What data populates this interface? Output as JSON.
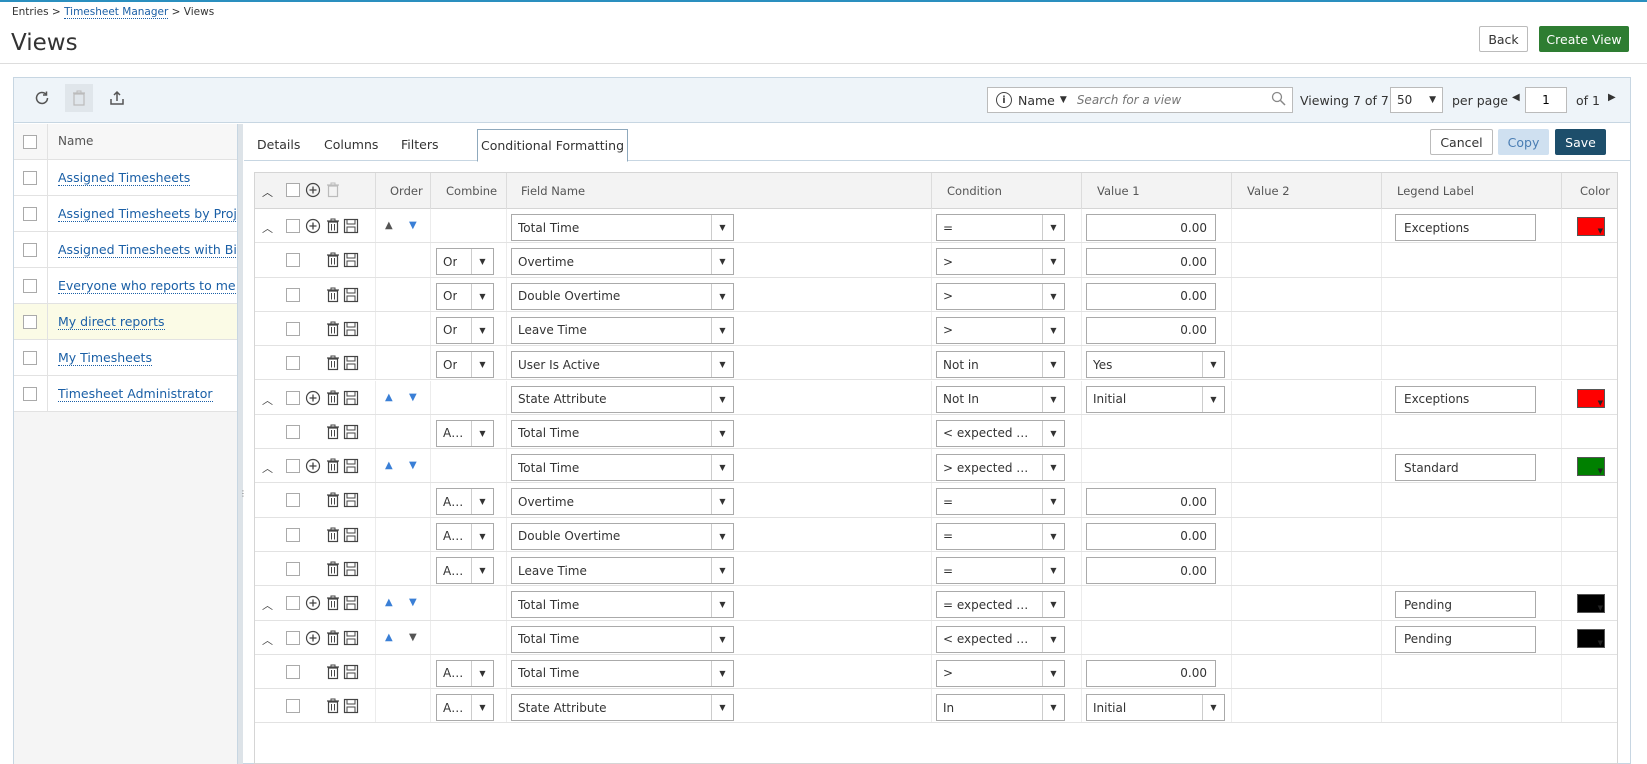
{
  "breadcrumb": {
    "entries": "Entries",
    "sep1": " > ",
    "manager": "Timesheet Manager",
    "sep2": " > ",
    "views": "Views"
  },
  "page_title": "Views",
  "header_buttons": {
    "back": "Back",
    "create": "Create View"
  },
  "toolbar": {
    "search_field": "Name",
    "search_placeholder": "Search for a view",
    "viewing_label": "Viewing",
    "viewing_count": "7 of 7",
    "per_page_value": "50",
    "per_page_label": "per page",
    "page_value": "1",
    "page_of": "of 1"
  },
  "left_list": {
    "header": "Name",
    "items": [
      "Assigned Timesheets",
      "Assigned Timesheets by Project",
      "Assigned Timesheets with Billab",
      "Everyone who reports to me",
      "My direct reports",
      "My Timesheets",
      "Timesheet Administrator"
    ],
    "selected_index": 4
  },
  "tabs": [
    "Details",
    "Columns",
    "Filters",
    "Conditional Formatting"
  ],
  "active_tab": "Conditional Formatting",
  "action_buttons": {
    "cancel": "Cancel",
    "copy": "Copy",
    "save": "Save"
  },
  "grid": {
    "headers": {
      "order": "Order",
      "combine": "Combine",
      "field": "Field Name",
      "condition": "Condition",
      "value1": "Value 1",
      "value2": "Value 2",
      "legend": "Legend Label",
      "color": "Color"
    },
    "rows": [
      {
        "group": true,
        "combine": "",
        "field": "Total Time",
        "condition": "=",
        "value1": "0.00",
        "value1_type": "number",
        "legend": "Exceptions",
        "color": "#ff0000"
      },
      {
        "group": false,
        "combine": "Or",
        "field": "Overtime",
        "condition": ">",
        "value1": "0.00",
        "value1_type": "number"
      },
      {
        "group": false,
        "combine": "Or",
        "field": "Double Overtime",
        "condition": ">",
        "value1": "0.00",
        "value1_type": "number"
      },
      {
        "group": false,
        "combine": "Or",
        "field": "Leave Time",
        "condition": ">",
        "value1": "0.00",
        "value1_type": "number"
      },
      {
        "group": false,
        "combine": "Or",
        "field": "User Is Active",
        "condition": "Not in",
        "value1": "Yes",
        "value1_type": "select"
      },
      {
        "group": true,
        "combine": "",
        "field": "State Attribute",
        "condition": "Not In",
        "value1": "Initial",
        "value1_type": "select",
        "legend": "Exceptions",
        "color": "#ff0000"
      },
      {
        "group": false,
        "combine": "And",
        "field": "Total Time",
        "condition": "< expected worki...",
        "value1": "",
        "value1_type": "none"
      },
      {
        "group": true,
        "combine": "",
        "field": "Total Time",
        "condition": "> expected worki...",
        "value1": "",
        "value1_type": "none",
        "legend": "Standard",
        "color": "#008000"
      },
      {
        "group": false,
        "combine": "And",
        "field": "Overtime",
        "condition": "=",
        "value1": "0.00",
        "value1_type": "number"
      },
      {
        "group": false,
        "combine": "And",
        "field": "Double Overtime",
        "condition": "=",
        "value1": "0.00",
        "value1_type": "number"
      },
      {
        "group": false,
        "combine": "And",
        "field": "Leave Time",
        "condition": "=",
        "value1": "0.00",
        "value1_type": "number"
      },
      {
        "group": true,
        "combine": "",
        "field": "Total Time",
        "condition": "= expected worki...",
        "value1": "",
        "value1_type": "none",
        "legend": "Pending",
        "color": "#000000"
      },
      {
        "group": true,
        "combine": "",
        "field": "Total Time",
        "condition": "< expected worki...",
        "value1": "",
        "value1_type": "none",
        "legend": "Pending",
        "color": "#000000"
      },
      {
        "group": false,
        "combine": "And",
        "field": "Total Time",
        "condition": ">",
        "value1": "0.00",
        "value1_type": "number"
      },
      {
        "group": false,
        "combine": "And",
        "field": "State Attribute",
        "condition": "In",
        "value1": "Initial",
        "value1_type": "select"
      }
    ]
  },
  "colors": {
    "accent_green": "#2e7d32",
    "save_dark": "#1d4e6b",
    "copy_light": "#cfe0f0",
    "link_blue": "#1a5fa6"
  }
}
